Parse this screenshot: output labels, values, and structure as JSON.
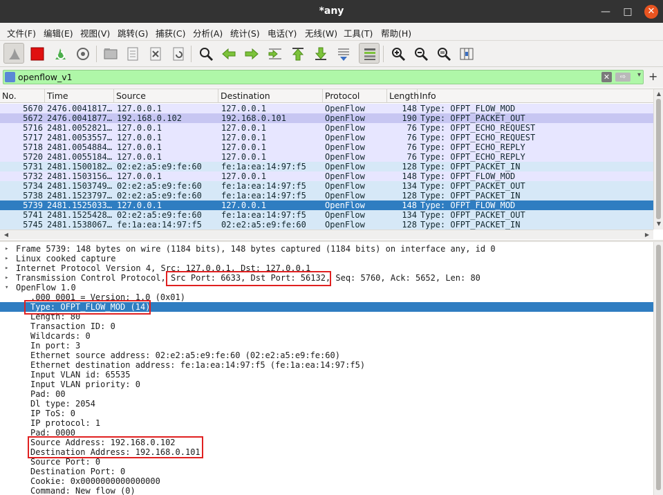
{
  "window": {
    "title": "*any",
    "minimize": "—",
    "maximize": "□",
    "close": "✕"
  },
  "menu": [
    {
      "label": "文件(F)"
    },
    {
      "label": "编辑(E)"
    },
    {
      "label": "视图(V)"
    },
    {
      "label": "跳转(G)"
    },
    {
      "label": "捕获(C)"
    },
    {
      "label": "分析(A)"
    },
    {
      "label": "统计(S)"
    },
    {
      "label": "电话(Y)"
    },
    {
      "label": "无线(W)"
    },
    {
      "label": "工具(T)"
    },
    {
      "label": "帮助(H)"
    }
  ],
  "toolbar_icons": [
    "shark-fin-start-icon",
    "stop-capture-icon",
    "restart-capture-icon",
    "capture-options-icon",
    "open-file-icon",
    "save-file-icon",
    "close-file-icon",
    "reload-file-icon",
    "find-packet-icon",
    "go-back-icon",
    "go-forward-icon",
    "go-to-packet-icon",
    "go-first-packet-icon",
    "go-last-packet-icon",
    "auto-scroll-icon",
    "colorize-icon",
    "zoom-in-icon",
    "zoom-out-icon",
    "normal-size-icon",
    "resize-columns-icon"
  ],
  "filter": {
    "value": "openflow_v1",
    "clear": "✕",
    "apply": "⇨",
    "dropdown": "▾",
    "add": "+"
  },
  "packet_list": {
    "columns": [
      "No.",
      "Time",
      "Source",
      "Destination",
      "Protocol",
      "Length",
      "Info"
    ],
    "rows": [
      {
        "no": "5670",
        "time": "2476.0041817…",
        "src": "127.0.0.1",
        "dst": "127.0.0.1",
        "proto": "OpenFlow",
        "len": "148",
        "info": "Type: OFPT_FLOW_MOD",
        "bg": "#e7e6ff"
      },
      {
        "no": "5672",
        "time": "2476.0041877…",
        "src": "192.168.0.102",
        "dst": "192.168.0.101",
        "proto": "OpenFlow",
        "len": "190",
        "info": "Type: OFPT_PACKET_OUT",
        "bg": "#c7c6f2"
      },
      {
        "no": "5716",
        "time": "2481.0052821…",
        "src": "127.0.0.1",
        "dst": "127.0.0.1",
        "proto": "OpenFlow",
        "len": "76",
        "info": "Type: OFPT_ECHO_REQUEST",
        "bg": "#e7e6ff"
      },
      {
        "no": "5717",
        "time": "2481.0053557…",
        "src": "127.0.0.1",
        "dst": "127.0.0.1",
        "proto": "OpenFlow",
        "len": "76",
        "info": "Type: OFPT_ECHO_REQUEST",
        "bg": "#e7e6ff"
      },
      {
        "no": "5718",
        "time": "2481.0054884…",
        "src": "127.0.0.1",
        "dst": "127.0.0.1",
        "proto": "OpenFlow",
        "len": "76",
        "info": "Type: OFPT_ECHO_REPLY",
        "bg": "#e7e6ff"
      },
      {
        "no": "5720",
        "time": "2481.0055184…",
        "src": "127.0.0.1",
        "dst": "127.0.0.1",
        "proto": "OpenFlow",
        "len": "76",
        "info": "Type: OFPT_ECHO_REPLY",
        "bg": "#e7e6ff"
      },
      {
        "no": "5731",
        "time": "2481.1500182…",
        "src": "02:e2:a5:e9:fe:60",
        "dst": "fe:1a:ea:14:97:f5",
        "proto": "OpenFlow",
        "len": "128",
        "info": "Type: OFPT_PACKET_IN",
        "bg": "#d6e8f7"
      },
      {
        "no": "5732",
        "time": "2481.1503156…",
        "src": "127.0.0.1",
        "dst": "127.0.0.1",
        "proto": "OpenFlow",
        "len": "148",
        "info": "Type: OFPT_FLOW_MOD",
        "bg": "#e7e6ff"
      },
      {
        "no": "5734",
        "time": "2481.1503749…",
        "src": "02:e2:a5:e9:fe:60",
        "dst": "fe:1a:ea:14:97:f5",
        "proto": "OpenFlow",
        "len": "134",
        "info": "Type: OFPT_PACKET_OUT",
        "bg": "#d6e8f7"
      },
      {
        "no": "5738",
        "time": "2481.1523797…",
        "src": "02:e2:a5:e9:fe:60",
        "dst": "fe:1a:ea:14:97:f5",
        "proto": "OpenFlow",
        "len": "128",
        "info": "Type: OFPT_PACKET_IN",
        "bg": "#d6e8f7"
      },
      {
        "no": "5739",
        "time": "2481.1525033…",
        "src": "127.0.0.1",
        "dst": "127.0.0.1",
        "proto": "OpenFlow",
        "len": "148",
        "info": "Type: OFPT_FLOW_MOD",
        "bg": "#2f7dc1",
        "selected": true
      },
      {
        "no": "5741",
        "time": "2481.1525428…",
        "src": "02:e2:a5:e9:fe:60",
        "dst": "fe:1a:ea:14:97:f5",
        "proto": "OpenFlow",
        "len": "134",
        "info": "Type: OFPT_PACKET_OUT",
        "bg": "#d6e8f7"
      },
      {
        "no": "5745",
        "time": "2481.1538067…",
        "src": "fe:1a:ea:14:97:f5",
        "dst": "02:e2:a5:e9:fe:60",
        "proto": "OpenFlow",
        "len": "128",
        "info": "Type: OFPT_PACKET_IN",
        "bg": "#d6e8f7"
      }
    ]
  },
  "details": {
    "lines": [
      {
        "arrow": "▸",
        "text": "Frame 5739: 148 bytes on wire (1184 bits), 148 bytes captured (1184 bits) on interface any, id 0"
      },
      {
        "arrow": "▸",
        "text": "Linux cooked capture"
      },
      {
        "arrow": "▸",
        "text": "Internet Protocol Version 4, Src: 127.0.0.1, Dst: 127.0.0.1"
      },
      {
        "arrow": "▸",
        "text": "Transmission Control Protocol, Src Port: 6633, Dst Port: 56132, Seq: 5760, Ack: 5652, Len: 80"
      },
      {
        "arrow": "▾",
        "text": "OpenFlow 1.0"
      },
      {
        "arrow": "",
        "text": ".000 0001 = Version: 1.0 (0x01)",
        "indent": true
      },
      {
        "arrow": "",
        "text": "Type: OFPT_FLOW_MOD (14)",
        "indent": true,
        "selected": true
      },
      {
        "arrow": "",
        "text": "Length: 80",
        "indent": true
      },
      {
        "arrow": "",
        "text": "Transaction ID: 0",
        "indent": true
      },
      {
        "arrow": "",
        "text": "Wildcards: 0",
        "indent": true
      },
      {
        "arrow": "",
        "text": "In port: 3",
        "indent": true
      },
      {
        "arrow": "",
        "text": "Ethernet source address: 02:e2:a5:e9:fe:60 (02:e2:a5:e9:fe:60)",
        "indent": true
      },
      {
        "arrow": "",
        "text": "Ethernet destination address: fe:1a:ea:14:97:f5 (fe:1a:ea:14:97:f5)",
        "indent": true
      },
      {
        "arrow": "",
        "text": "Input VLAN id: 65535",
        "indent": true
      },
      {
        "arrow": "",
        "text": "Input VLAN priority: 0",
        "indent": true
      },
      {
        "arrow": "",
        "text": "Pad: 00",
        "indent": true
      },
      {
        "arrow": "",
        "text": "Dl type: 2054",
        "indent": true
      },
      {
        "arrow": "",
        "text": "IP ToS: 0",
        "indent": true
      },
      {
        "arrow": "",
        "text": "IP protocol: 1",
        "indent": true
      },
      {
        "arrow": "",
        "text": "Pad: 0000",
        "indent": true
      },
      {
        "arrow": "",
        "text": "Source Address: 192.168.0.102",
        "indent": true
      },
      {
        "arrow": "",
        "text": "Destination Address: 192.168.0.101",
        "indent": true
      },
      {
        "arrow": "",
        "text": "Source Port: 0",
        "indent": true
      },
      {
        "arrow": "",
        "text": "Destination Port: 0",
        "indent": true
      },
      {
        "arrow": "",
        "text": "Cookie: 0x0000000000000000",
        "indent": true
      },
      {
        "arrow": "",
        "text": "Command: New flow (0)",
        "indent": true
      }
    ]
  },
  "colors": {
    "selected": "#2f7dc1",
    "highlight_box": "#e02020",
    "filter_ok": "#aff7a8"
  }
}
